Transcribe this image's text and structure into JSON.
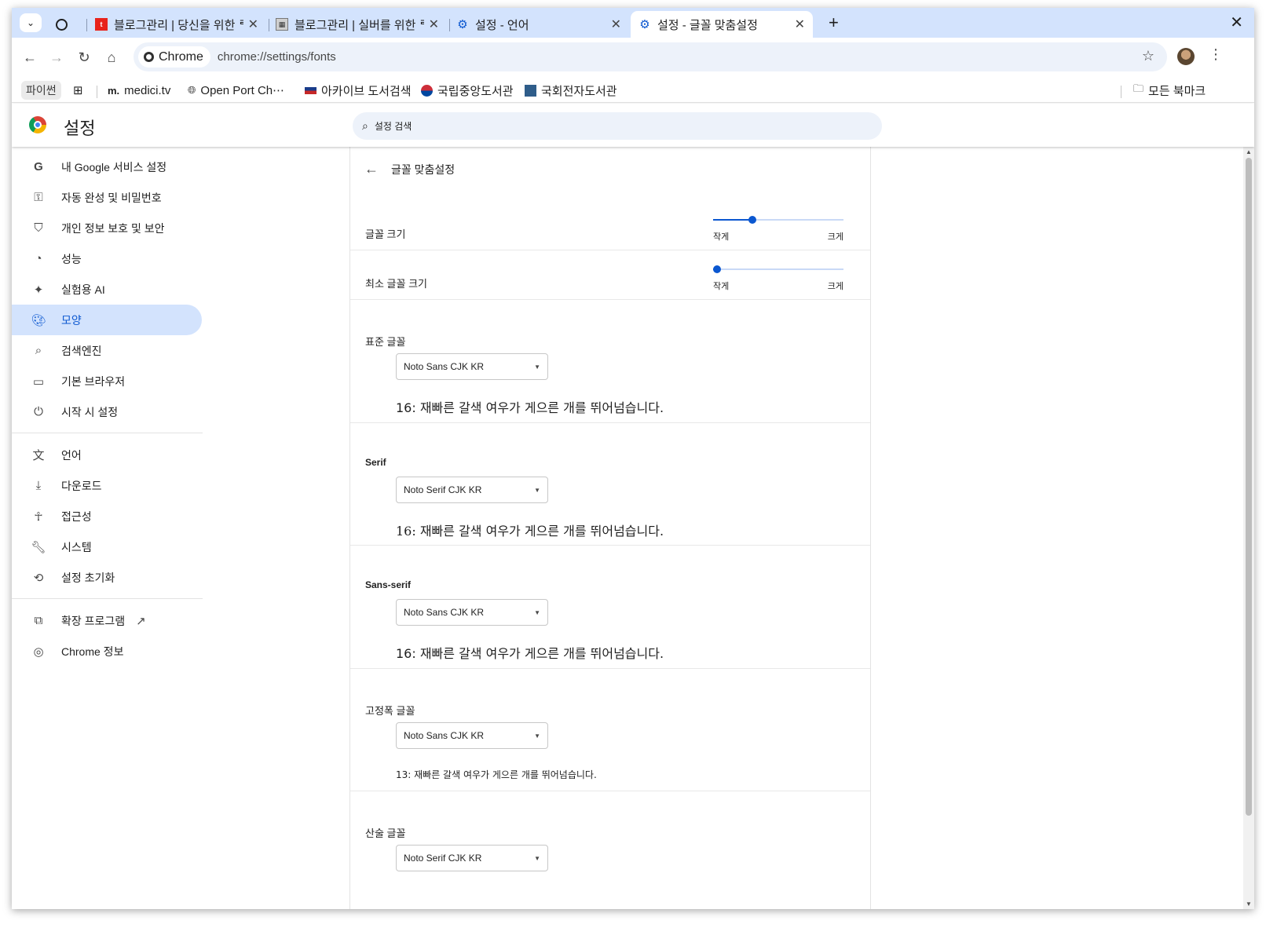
{
  "tabs": [
    {
      "title": "블로그관리 | 당신을 위한 ᄅ",
      "close": "✕"
    },
    {
      "title": "블로그관리 | 실버를 위한 ᄅ",
      "close": "✕"
    },
    {
      "title": "설정 - 언어",
      "close": "✕"
    },
    {
      "title": "설정 - 글꼴 맞춤설정",
      "close": "✕"
    }
  ],
  "toolbar": {
    "chip_label": "Chrome",
    "url": "chrome://settings/fonts"
  },
  "bookmarks": {
    "group_label": "파이썬",
    "items": [
      {
        "label": "medici.tv",
        "prefix": "m."
      },
      {
        "label": "Open Port Ch⋯"
      },
      {
        "label": "아카이브 도서검색"
      },
      {
        "label": "국립중앙도서관"
      },
      {
        "label": "국회전자도서관"
      }
    ],
    "all_bookmarks": "모든 북마크"
  },
  "settings": {
    "title": "설정",
    "search_placeholder": "설정 검색"
  },
  "sidebar": {
    "items": [
      {
        "label": "내 Google 서비스 설정",
        "icon": "google-icon"
      },
      {
        "label": "자동 완성 및 비밀번호",
        "icon": "key-icon"
      },
      {
        "label": "개인 정보 보호 및 보안",
        "icon": "shield-icon"
      },
      {
        "label": "성능",
        "icon": "speedometer-icon"
      },
      {
        "label": "실험용 AI",
        "icon": "sparkle-icon"
      },
      {
        "label": "모양",
        "icon": "palette-icon"
      },
      {
        "label": "검색엔진",
        "icon": "search-icon"
      },
      {
        "label": "기본 브라우저",
        "icon": "browser-window-icon"
      },
      {
        "label": "시작 시 설정",
        "icon": "power-icon"
      }
    ],
    "items2": [
      {
        "label": "언어",
        "icon": "translate-icon"
      },
      {
        "label": "다운로드",
        "icon": "download-icon"
      },
      {
        "label": "접근성",
        "icon": "accessibility-icon"
      },
      {
        "label": "시스템",
        "icon": "wrench-icon"
      },
      {
        "label": "설정 초기화",
        "icon": "reset-icon"
      }
    ],
    "items3": [
      {
        "label": "확장 프로그램",
        "icon": "puzzle-icon"
      },
      {
        "label": "Chrome 정보",
        "icon": "chrome-icon"
      }
    ],
    "active": "모양"
  },
  "page": {
    "heading": "글꼴 맞춤설정",
    "font_size": {
      "label": "글꼴 크기",
      "min_label": "작게",
      "max_label": "크게",
      "level": 0.29
    },
    "min_font_size": {
      "label": "최소 글꼴 크기",
      "min_label": "작게",
      "max_label": "크게",
      "level": 0.0
    },
    "fonts": [
      {
        "label": "표준 글꼴",
        "value": "Noto Sans CJK KR",
        "sample": "16: 재빠른 갈색 여우가 게으른 개를 뛰어넘습니다."
      },
      {
        "label": "Serif",
        "value": "Noto Serif CJK KR",
        "sample": "16: 재빠른 갈색 여우가 게으른 개를 뛰어넘습니다."
      },
      {
        "label": "Sans-serif",
        "value": "Noto Sans CJK KR",
        "sample": "16: 재빠른 갈색 여우가 게으른 개를 뛰어넘습니다."
      },
      {
        "label": "고정폭 글꼴",
        "value": "Noto Sans CJK KR",
        "sample": "13: 재빠른 갈색 여우가 게으른 개를 뛰어넘습니다."
      },
      {
        "label": "산술 글꼴",
        "value": "Noto Serif CJK KR"
      }
    ]
  },
  "colors": {
    "accent": "#0b57d0",
    "active_bg": "#d3e3fd",
    "tabstrip_bg": "#d3e3fd"
  }
}
